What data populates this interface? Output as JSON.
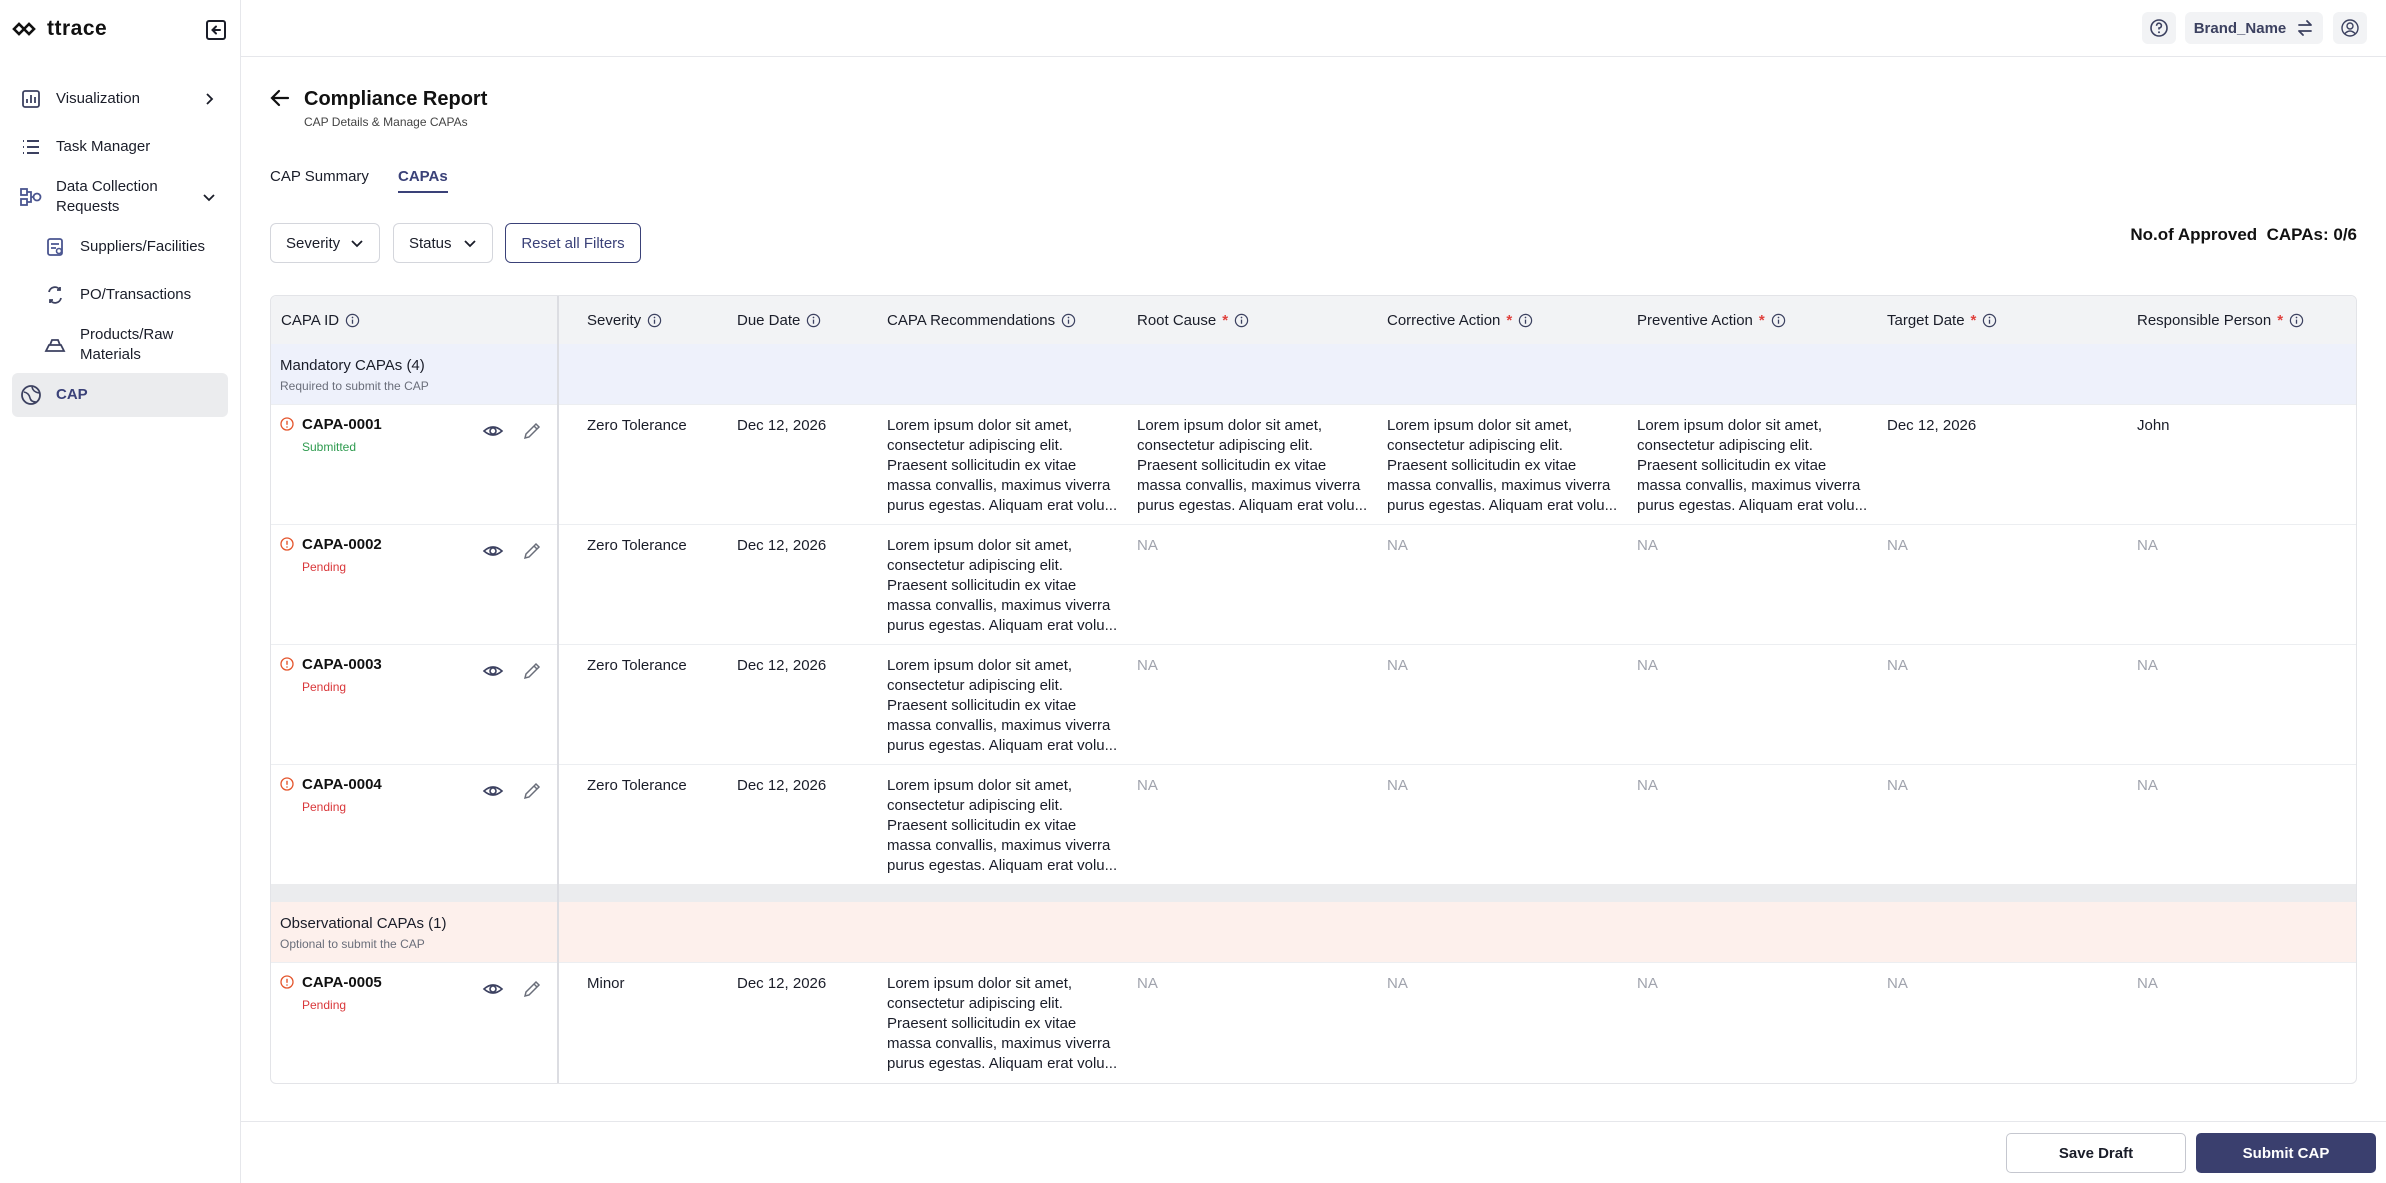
{
  "app": {
    "logo_text": "ttrace"
  },
  "sidebar": {
    "items": [
      {
        "label": "Visualization",
        "icon": "chart-icon"
      },
      {
        "label": "Task Manager",
        "icon": "list-icon"
      },
      {
        "label": "Data Collection Requests",
        "icon": "data-flow-icon"
      },
      {
        "label": "Suppliers/Facilities",
        "icon": "supplier-icon"
      },
      {
        "label": "PO/Transactions",
        "icon": "transactions-icon"
      },
      {
        "label": "Products/Raw Materials",
        "icon": "products-icon"
      },
      {
        "label": "CAP",
        "icon": "cap-icon"
      }
    ]
  },
  "topbar": {
    "brand": "Brand_Name"
  },
  "header": {
    "title": "Compliance Report",
    "subtitle": "CAP Details & Manage CAPAs"
  },
  "tabs": [
    {
      "label": "CAP Summary"
    },
    {
      "label": "CAPAs"
    }
  ],
  "filters": {
    "severity": "Severity",
    "status": "Status",
    "reset": "Reset all Filters"
  },
  "approved": {
    "label": "No.of Approved  CAPAs: 0/6"
  },
  "table": {
    "columns": [
      {
        "label": "CAPA ID"
      },
      {
        "label": "Severity"
      },
      {
        "label": "Due Date"
      },
      {
        "label": "CAPA Recommendations"
      },
      {
        "label": "Root Cause",
        "required": "*"
      },
      {
        "label": "Corrective Action",
        "required": "*"
      },
      {
        "label": "Preventive Action",
        "required": "*"
      },
      {
        "label": "Target Date",
        "required": "*"
      },
      {
        "label": "Responsible Person",
        "required": "*"
      }
    ],
    "groups": {
      "mandatory": {
        "title": "Mandatory CAPAs (4)",
        "subtitle": "Required to submit the CAP"
      },
      "observational": {
        "title": "Observational CAPAs (1)",
        "subtitle": "Optional to submit the CAP"
      }
    },
    "rows": [
      {
        "id": "CAPA-0001",
        "status": "Submitted",
        "severity": "Zero Tolerance",
        "due": "Dec 12, 2026",
        "rec": "Lorem ipsum dolor sit amet, consectetur adipiscing elit. Praesent sollicitudin ex vitae massa convallis, maximus viverra purus egestas. Aliquam erat volu...",
        "root": "Lorem ipsum dolor sit amet, consectetur adipiscing elit. Praesent sollicitudin ex vitae massa convallis, maximus viverra purus egestas. Aliquam erat volu...",
        "corr": "Lorem ipsum dolor sit amet, consectetur adipiscing elit. Praesent sollicitudin ex vitae massa convallis, maximus viverra purus egestas. Aliquam erat volu...",
        "prev": "Lorem ipsum dolor sit amet, consectetur adipiscing elit. Praesent sollicitudin ex vitae massa convallis, maximus viverra purus egestas. Aliquam erat volu...",
        "target": "Dec 12, 2026",
        "person": "John"
      },
      {
        "id": "CAPA-0002",
        "status": "Pending",
        "severity": "Zero Tolerance",
        "due": "Dec 12, 2026",
        "rec": "Lorem ipsum dolor sit amet, consectetur adipiscing elit. Praesent sollicitudin ex vitae massa convallis, maximus viverra purus egestas. Aliquam erat volu...",
        "root": "NA",
        "corr": "NA",
        "prev": "NA",
        "target": "NA",
        "person": "NA"
      },
      {
        "id": "CAPA-0003",
        "status": "Pending",
        "severity": "Zero Tolerance",
        "due": "Dec 12, 2026",
        "rec": "Lorem ipsum dolor sit amet, consectetur adipiscing elit. Praesent sollicitudin ex vitae massa convallis, maximus viverra purus egestas. Aliquam erat volu...",
        "root": "NA",
        "corr": "NA",
        "prev": "NA",
        "target": "NA",
        "person": "NA"
      },
      {
        "id": "CAPA-0004",
        "status": "Pending",
        "severity": "Zero Tolerance",
        "due": "Dec 12, 2026",
        "rec": "Lorem ipsum dolor sit amet, consectetur adipiscing elit. Praesent sollicitudin ex vitae massa convallis, maximus viverra purus egestas. Aliquam erat volu...",
        "root": "NA",
        "corr": "NA",
        "prev": "NA",
        "target": "NA",
        "person": "NA"
      },
      {
        "id": "CAPA-0005",
        "status": "Pending",
        "severity": "Minor",
        "due": "Dec 12, 2026",
        "rec": "Lorem ipsum dolor sit amet, consectetur adipiscing elit. Praesent sollicitudin ex vitae massa convallis, maximus viverra purus egestas. Aliquam erat volu...",
        "root": "NA",
        "corr": "NA",
        "prev": "NA",
        "target": "NA",
        "person": "NA"
      }
    ]
  },
  "footer": {
    "save": "Save Draft",
    "submit": "Submit CAP"
  },
  "colors": {
    "accent": "#3a4178",
    "submitted": "#2e9b4f",
    "pending": "#d9373a",
    "required": "#e0413d"
  }
}
